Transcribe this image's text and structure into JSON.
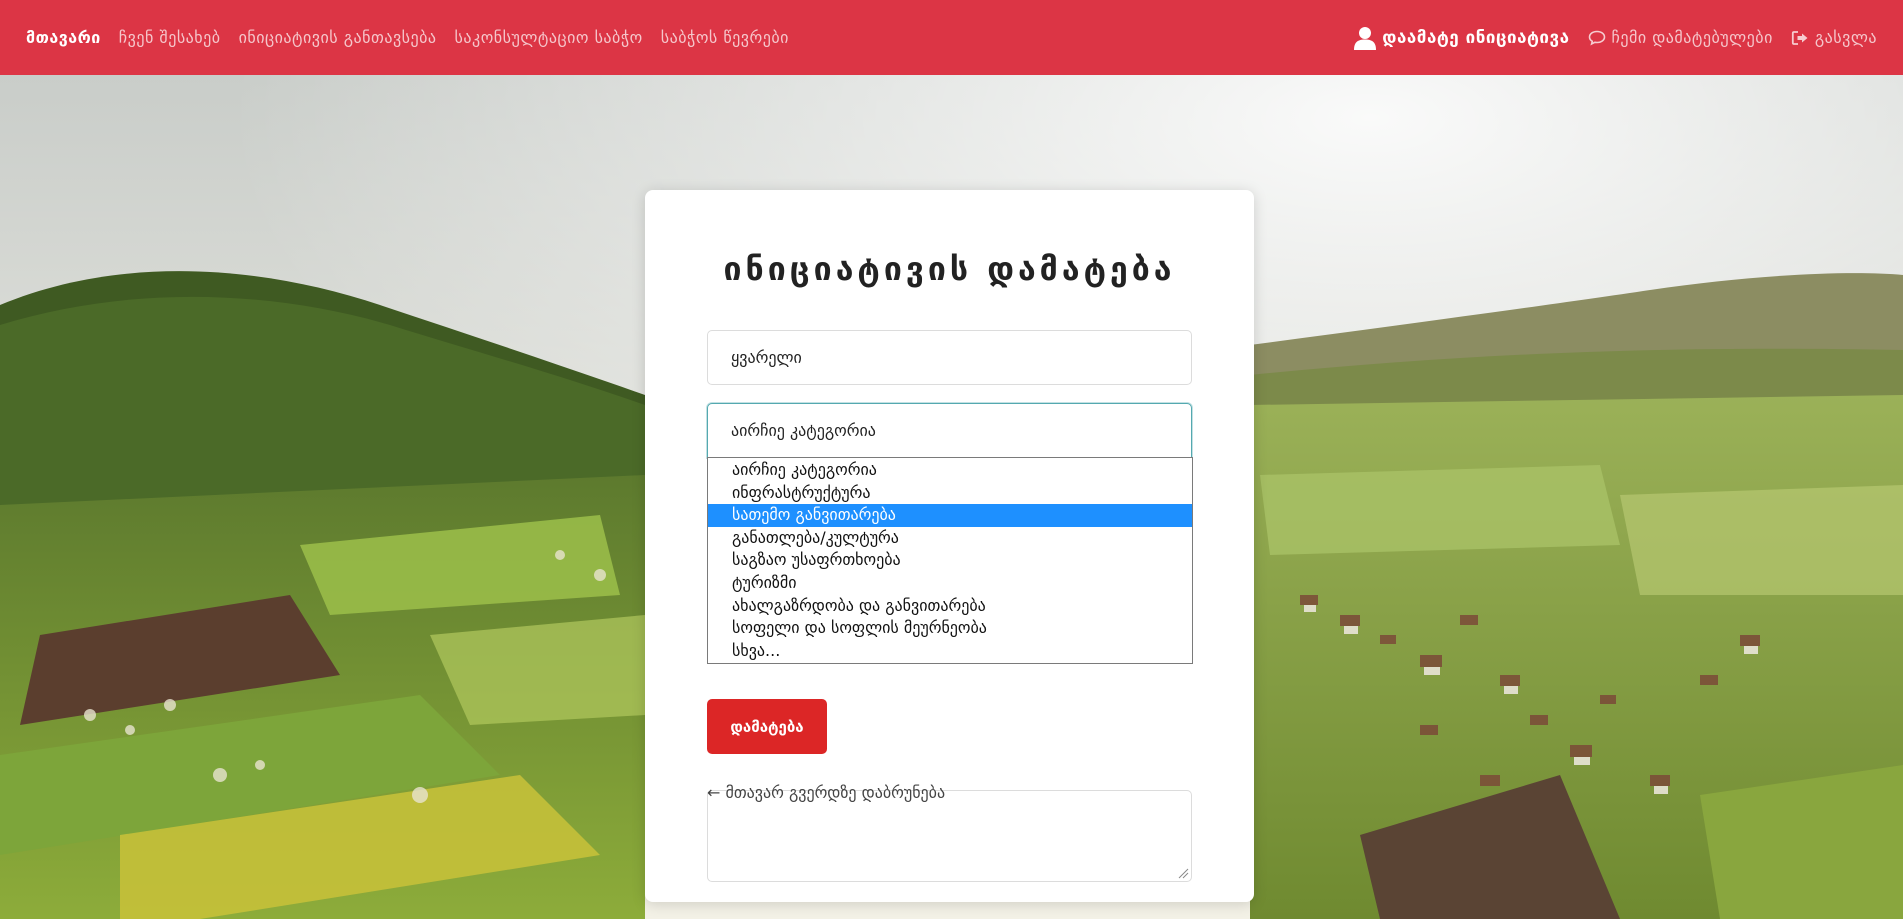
{
  "navbar": {
    "left_links": [
      {
        "label": "მთავარი",
        "active": true
      },
      {
        "label": "ჩვენ შესახებ",
        "active": false
      },
      {
        "label": "ინიციატივის განთავსება",
        "active": false
      },
      {
        "label": "საკონსულტაციო საბჭო",
        "active": false
      },
      {
        "label": "საბჭოს წევრები",
        "active": false
      }
    ],
    "add_initiative": {
      "label": "დაამატე ინიციატივა",
      "icon": "user-icon"
    },
    "my_comments": {
      "label": "ჩემი დამატებულები",
      "icon": "comment-icon"
    },
    "logout": {
      "label": "გასვლა",
      "icon": "sign-out-icon"
    },
    "color": "#dc3545"
  },
  "form": {
    "title": "ინიციატივის დამატება",
    "name_value": "ყვარელი",
    "category_selected": "აირჩიე კატეგორია",
    "category_options": [
      "აირჩიე კატეგორია",
      "ინფრასტრუქტურა",
      "სათემო განვითარება",
      "განათლება/კულტურა",
      "საგზაო უსაფრთხოება",
      "ტურიზმი",
      "ახალგაზრდობა და განვითარება",
      "სოფელი და სოფლის მეურნეობა",
      "სხვა..."
    ],
    "highlighted_option_index": 2,
    "submit_label": "დამატება",
    "back_link": "← მთავარ გვერდზე დაბრუნება",
    "highlight_color": "#1e90ff",
    "button_color": "#dc2626"
  }
}
